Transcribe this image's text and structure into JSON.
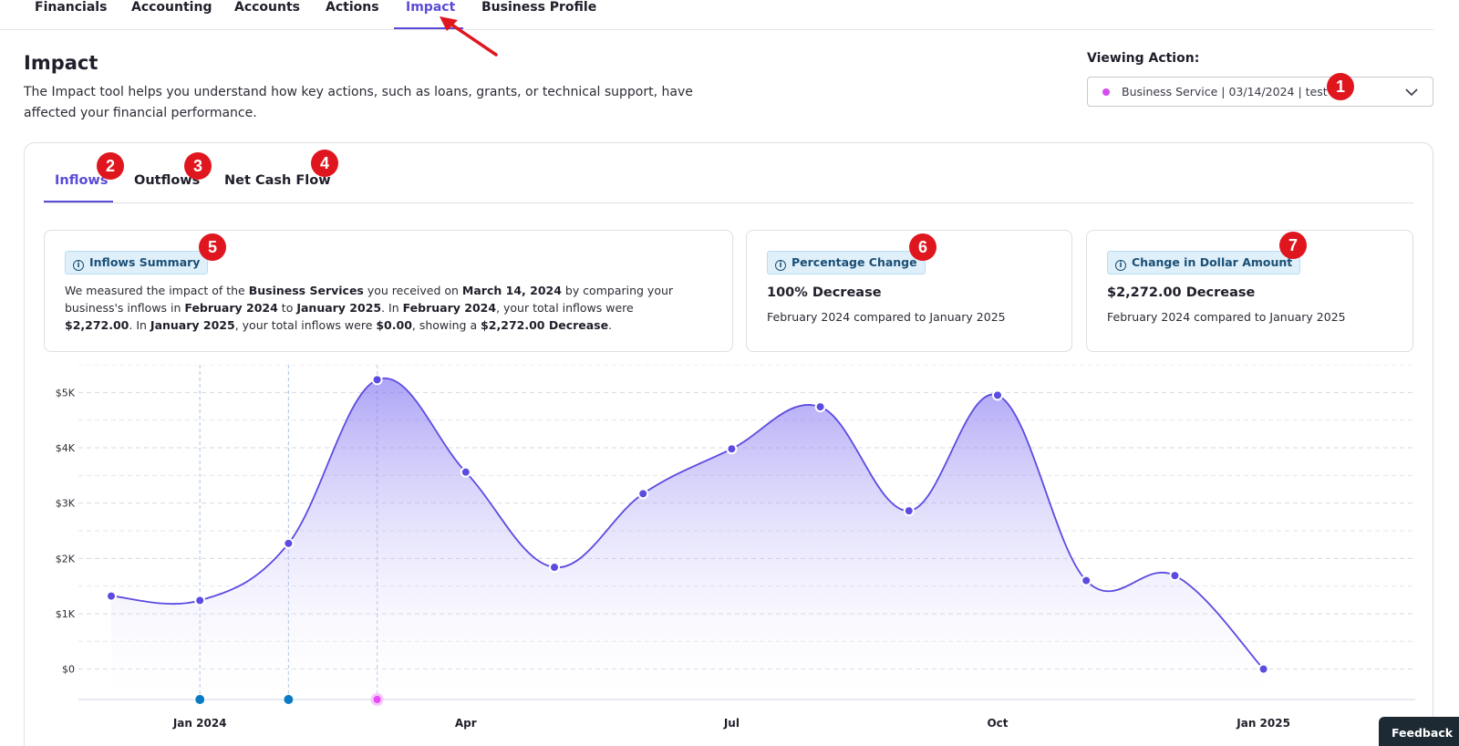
{
  "nav": {
    "items": [
      {
        "label": "Financials",
        "active": false
      },
      {
        "label": "Accounting",
        "active": false
      },
      {
        "label": "Accounts",
        "active": false
      },
      {
        "label": "Actions",
        "active": false
      },
      {
        "label": "Impact",
        "active": true
      },
      {
        "label": "Business Profile",
        "active": false
      }
    ]
  },
  "header": {
    "title": "Impact",
    "description": "The Impact tool helps you understand how key actions, such as loans, grants, or technical support, have affected your financial performance."
  },
  "viewing": {
    "label": "Viewing Action:",
    "selected": "Business Service | 03/14/2024 | test",
    "dot_color": "#d44bf0"
  },
  "badges": [
    "1",
    "2",
    "3",
    "4",
    "5",
    "6",
    "7"
  ],
  "tabs": [
    {
      "label": "Inflows",
      "active": true
    },
    {
      "label": "Outflows",
      "active": false
    },
    {
      "label": "Net Cash Flow",
      "active": false
    }
  ],
  "summary": {
    "title": "Inflows Summary",
    "segments": [
      {
        "t": "We measured the impact of the ",
        "b": false
      },
      {
        "t": "Business Services",
        "b": true
      },
      {
        "t": " you received on ",
        "b": false
      },
      {
        "t": "March 14, 2024",
        "b": true
      },
      {
        "t": " by comparing your business's inflows in ",
        "b": false
      },
      {
        "t": "February 2024",
        "b": true
      },
      {
        "t": " to ",
        "b": false
      },
      {
        "t": "January 2025",
        "b": true
      },
      {
        "t": ". In ",
        "b": false
      },
      {
        "t": "February 2024",
        "b": true
      },
      {
        "t": ", your total inflows were ",
        "b": false
      },
      {
        "t": "$2,272.00",
        "b": true
      },
      {
        "t": ". In ",
        "b": false
      },
      {
        "t": "January 2025",
        "b": true
      },
      {
        "t": ", your total inflows were ",
        "b": false
      },
      {
        "t": "$0.00",
        "b": true
      },
      {
        "t": ", showing a ",
        "b": false
      },
      {
        "t": "$2,272.00 Decrease",
        "b": true
      },
      {
        "t": ".",
        "b": false
      }
    ]
  },
  "percentage": {
    "title": "Percentage Change",
    "value": "100% Decrease",
    "sub": "February 2024 compared to January 2025"
  },
  "dollar": {
    "title": "Change in Dollar Amount",
    "value": "$2,272.00 Decrease",
    "sub": "February 2024 compared to January 2025"
  },
  "feedback": {
    "label": "Feedback"
  },
  "colors": {
    "accent": "#5a4bd6",
    "line": "#5b4be0",
    "marker_blue": "#0a7bc2",
    "marker_pink": "#e64bf5",
    "badge": "#e0161f"
  },
  "chart_data": {
    "type": "area",
    "x": [
      "Dec 2023",
      "Jan 2024",
      "Feb 2024",
      "Mar 2024",
      "Apr 2024",
      "May 2024",
      "Jun 2024",
      "Jul 2024",
      "Aug 2024",
      "Sep 2024",
      "Oct 2024",
      "Nov 2024",
      "Dec 2024",
      "Jan 2025"
    ],
    "values": [
      1320,
      1240,
      2272,
      5230,
      3560,
      1840,
      3170,
      3980,
      4740,
      2860,
      4950,
      1600,
      1690,
      0
    ],
    "ylim": [
      -550,
      5500
    ],
    "yticks": [
      0,
      1000,
      2000,
      3000,
      4000,
      5000
    ],
    "ytick_labels": [
      "$0",
      "$1K",
      "$2K",
      "$3K",
      "$4K",
      "$5K"
    ],
    "xtick_labels": [
      {
        "x": "Jan 2024",
        "label": "Jan 2024"
      },
      {
        "x": "Apr 2024",
        "label": "Apr"
      },
      {
        "x": "Jul 2024",
        "label": "Jul"
      },
      {
        "x": "Oct 2024",
        "label": "Oct"
      },
      {
        "x": "Jan 2025",
        "label": "Jan 2025"
      }
    ],
    "event_markers": [
      {
        "x": "Jan 2024",
        "color": "blue"
      },
      {
        "x": "Feb 2024",
        "color": "blue"
      },
      {
        "x": "Mar 2024",
        "color": "pink"
      }
    ],
    "grid": true,
    "title": "",
    "xlabel": "",
    "ylabel": ""
  }
}
